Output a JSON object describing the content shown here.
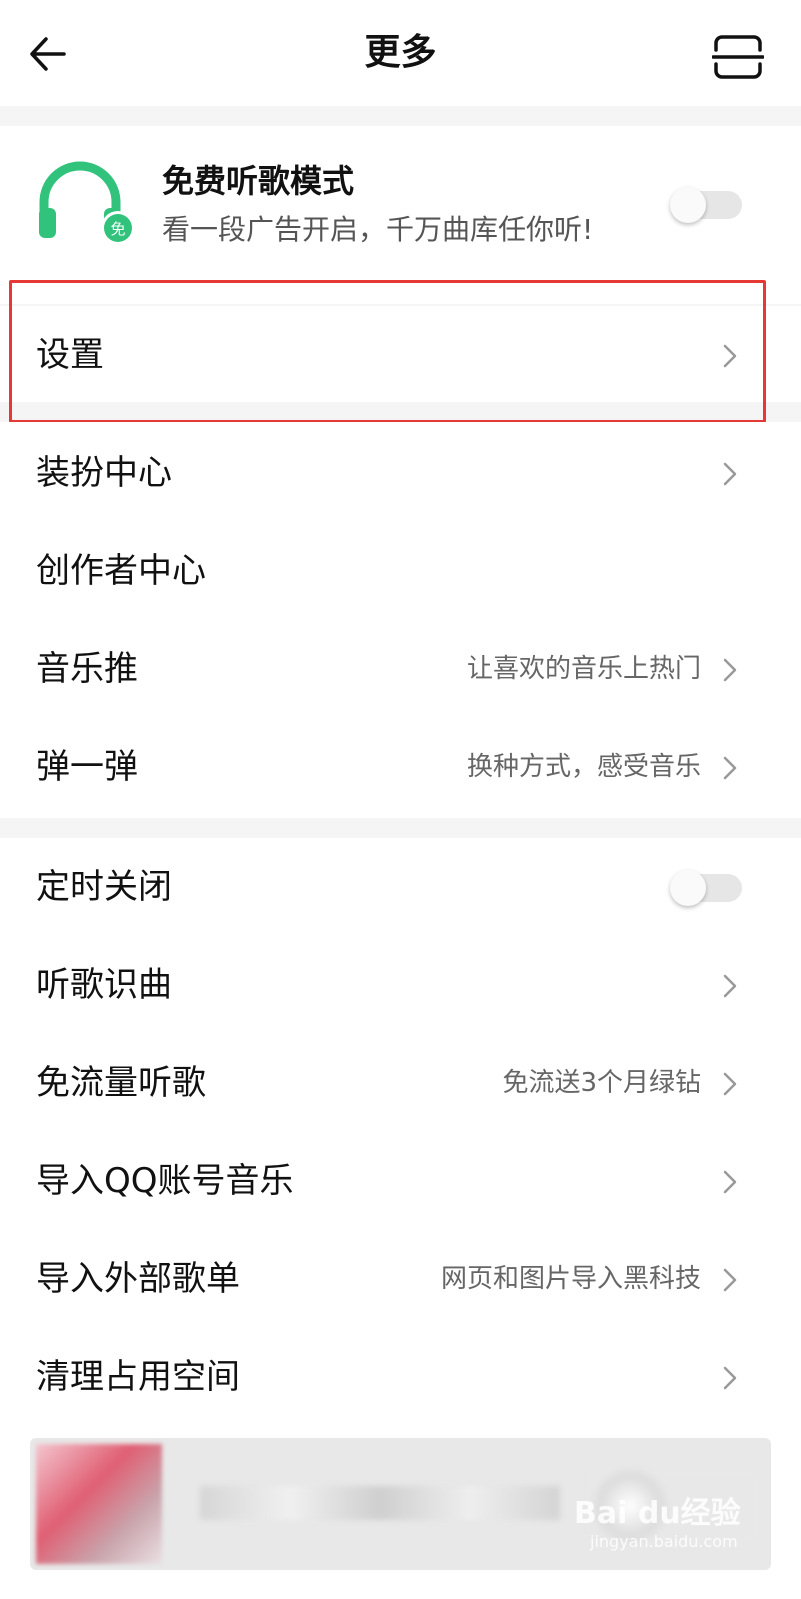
{
  "header": {
    "title": "更多"
  },
  "free_mode": {
    "title": "免费听歌模式",
    "subtitle": "看一段广告开启，千万曲库任你听!",
    "badge": "免",
    "enabled": false
  },
  "settings": {
    "label": "设置"
  },
  "menu_group_1": [
    {
      "label": "装扮中心",
      "sub": "",
      "chevron": true
    },
    {
      "label": "创作者中心",
      "sub": "",
      "chevron": false
    },
    {
      "label": "音乐推",
      "sub": "让喜欢的音乐上热门",
      "chevron": true
    },
    {
      "label": "弹一弹",
      "sub": "换种方式，感受音乐",
      "chevron": true
    }
  ],
  "menu_group_2": [
    {
      "label": "定时关闭",
      "sub": "",
      "toggle": true,
      "enabled": false
    },
    {
      "label": "听歌识曲",
      "sub": "",
      "chevron": true
    },
    {
      "label": "免流量听歌",
      "sub": "免流送3个月绿钻",
      "chevron": true
    },
    {
      "label": "导入QQ账号音乐",
      "sub": "",
      "chevron": true
    },
    {
      "label": "导入外部歌单",
      "sub": "网页和图片导入黑科技",
      "chevron": true
    },
    {
      "label": "清理占用空间",
      "sub": "",
      "chevron": true
    }
  ],
  "watermark": {
    "brand": "Bai du经验",
    "url": "jingyan.baidu.com"
  },
  "colors": {
    "accent_green": "#31c27c",
    "highlight_red": "#e53935"
  },
  "icons": [
    "back-arrow-icon",
    "scan-icon",
    "headphones-icon",
    "chevron-right-icon"
  ]
}
